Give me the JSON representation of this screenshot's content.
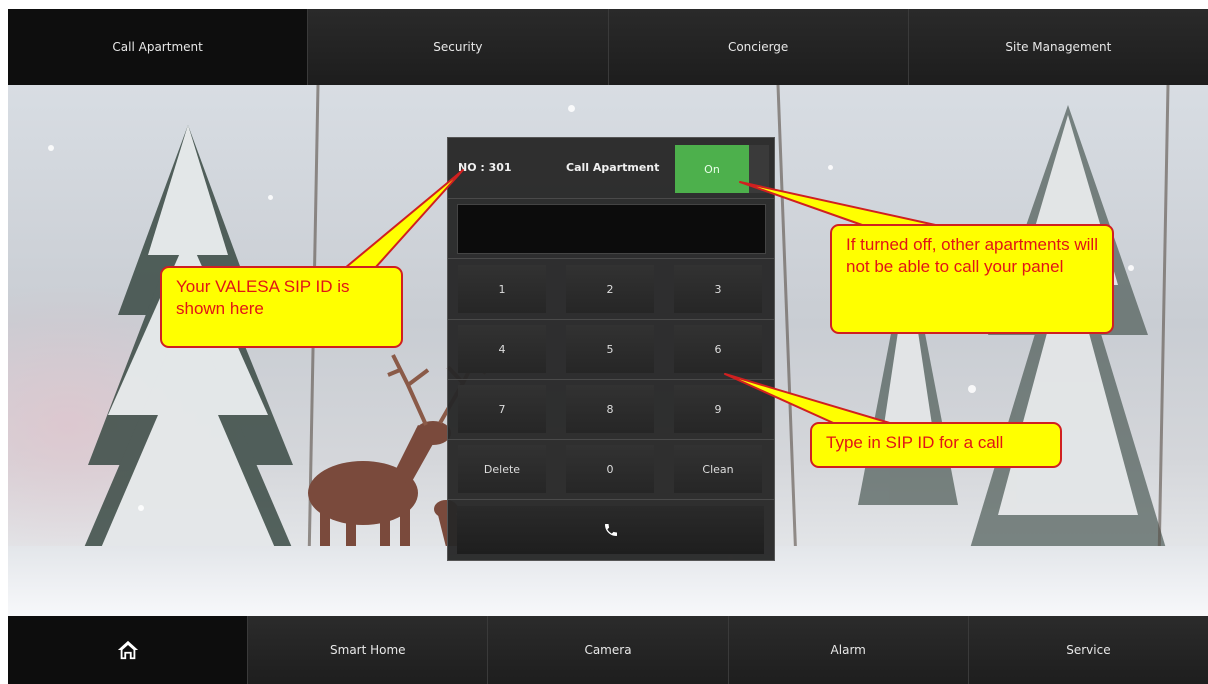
{
  "top_nav": {
    "tabs": [
      {
        "label": "Call Apartment"
      },
      {
        "label": "Security"
      },
      {
        "label": "Concierge"
      },
      {
        "label": "Site Management"
      }
    ]
  },
  "panel": {
    "sip_id": "NO : 301",
    "title": "Call Apartment",
    "toggle_label": "On",
    "keys": [
      "1",
      "2",
      "3",
      "4",
      "5",
      "6",
      "7",
      "8",
      "9",
      "Delete",
      "0",
      "Clean"
    ],
    "call_icon": "phone-icon"
  },
  "callouts": {
    "sip_id": "Your VALESA SIP ID is shown here",
    "toggle": "If turned off, other apartments will not be able to call your panel",
    "keypad": "Type in SIP ID for a call"
  },
  "bottom_nav": {
    "home_icon": "home-icon",
    "tabs": [
      {
        "label": "Smart Home"
      },
      {
        "label": "Camera"
      },
      {
        "label": "Alarm"
      },
      {
        "label": "Service"
      }
    ]
  },
  "colors": {
    "toggle_on": "#4db04c",
    "callout_fill": "#ffff00",
    "callout_text": "#e11515"
  }
}
